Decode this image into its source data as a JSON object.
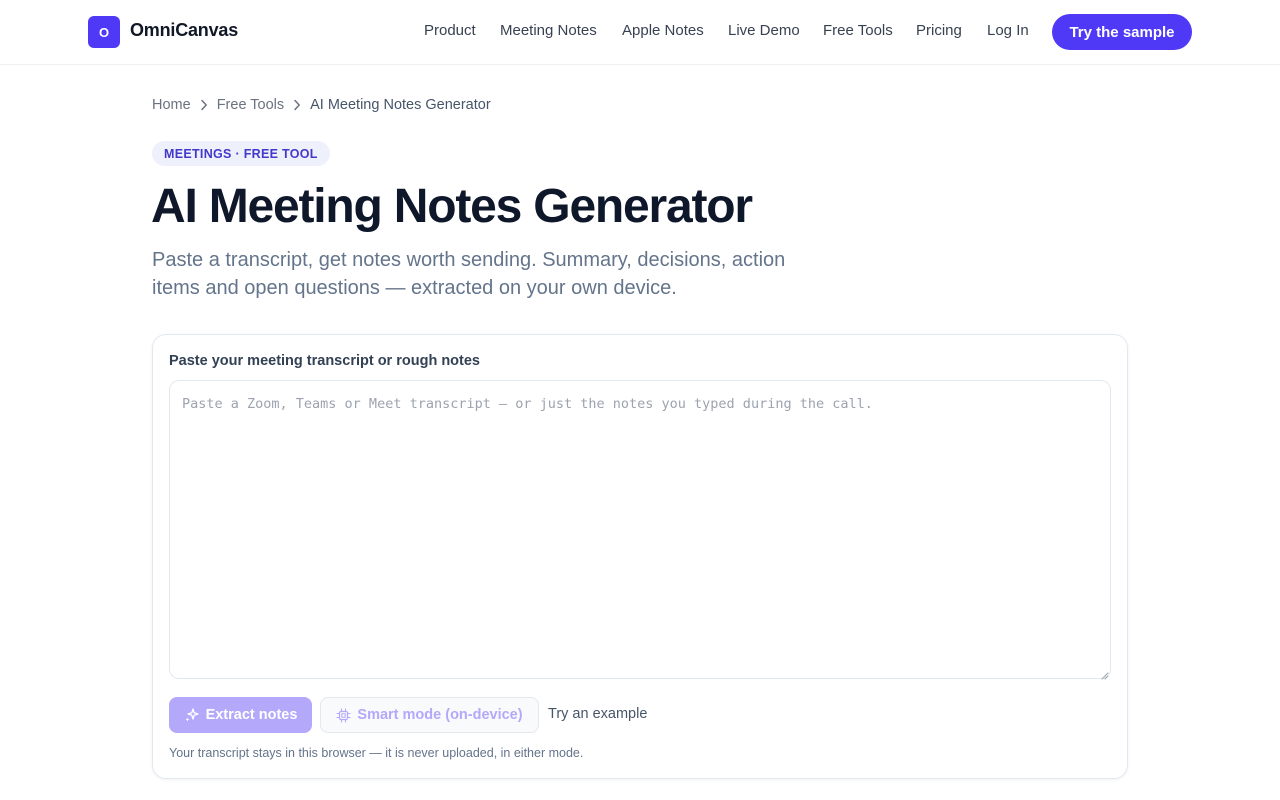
{
  "header": {
    "logo_letter": "O",
    "brand": "OmniCanvas",
    "nav": [
      {
        "label": "Product"
      },
      {
        "label": "Meeting Notes"
      },
      {
        "label": "Apple Notes"
      },
      {
        "label": "Live Demo"
      },
      {
        "label": "Free Tools"
      },
      {
        "label": "Pricing"
      },
      {
        "label": "Log In"
      }
    ],
    "cta_label": "Try the sample"
  },
  "breadcrumb": {
    "items": [
      "Home",
      "Free Tools",
      "AI Meeting Notes Generator"
    ]
  },
  "hero": {
    "tag": "MEETINGS · FREE TOOL",
    "title": "AI Meeting Notes Generator",
    "subtitle": "Paste a transcript, get notes worth sending. Summary, decisions, action items and open questions — extracted on your own device."
  },
  "tool": {
    "input_label": "Paste your meeting transcript or rough notes",
    "input_value": "",
    "input_placeholder": "Paste a Zoom, Teams or Meet transcript — or just the notes you typed during the call.",
    "extract_label": "Extract notes",
    "smart_mode_label": "Smart mode (on-device)",
    "example_label": "Try an example",
    "privacy_note": "Your transcript stays in this browser — it is never uploaded, in either mode."
  },
  "colors": {
    "accent": "#4f39f6",
    "accent_disabled": "#b4a8fb",
    "pill_bg": "#eef0fb",
    "pill_text": "#4338ca"
  },
  "icons": {
    "extract": "sparkles-icon",
    "smart_mode": "cpu-chip-icon",
    "breadcrumb_separator": "chevron-right-icon"
  }
}
